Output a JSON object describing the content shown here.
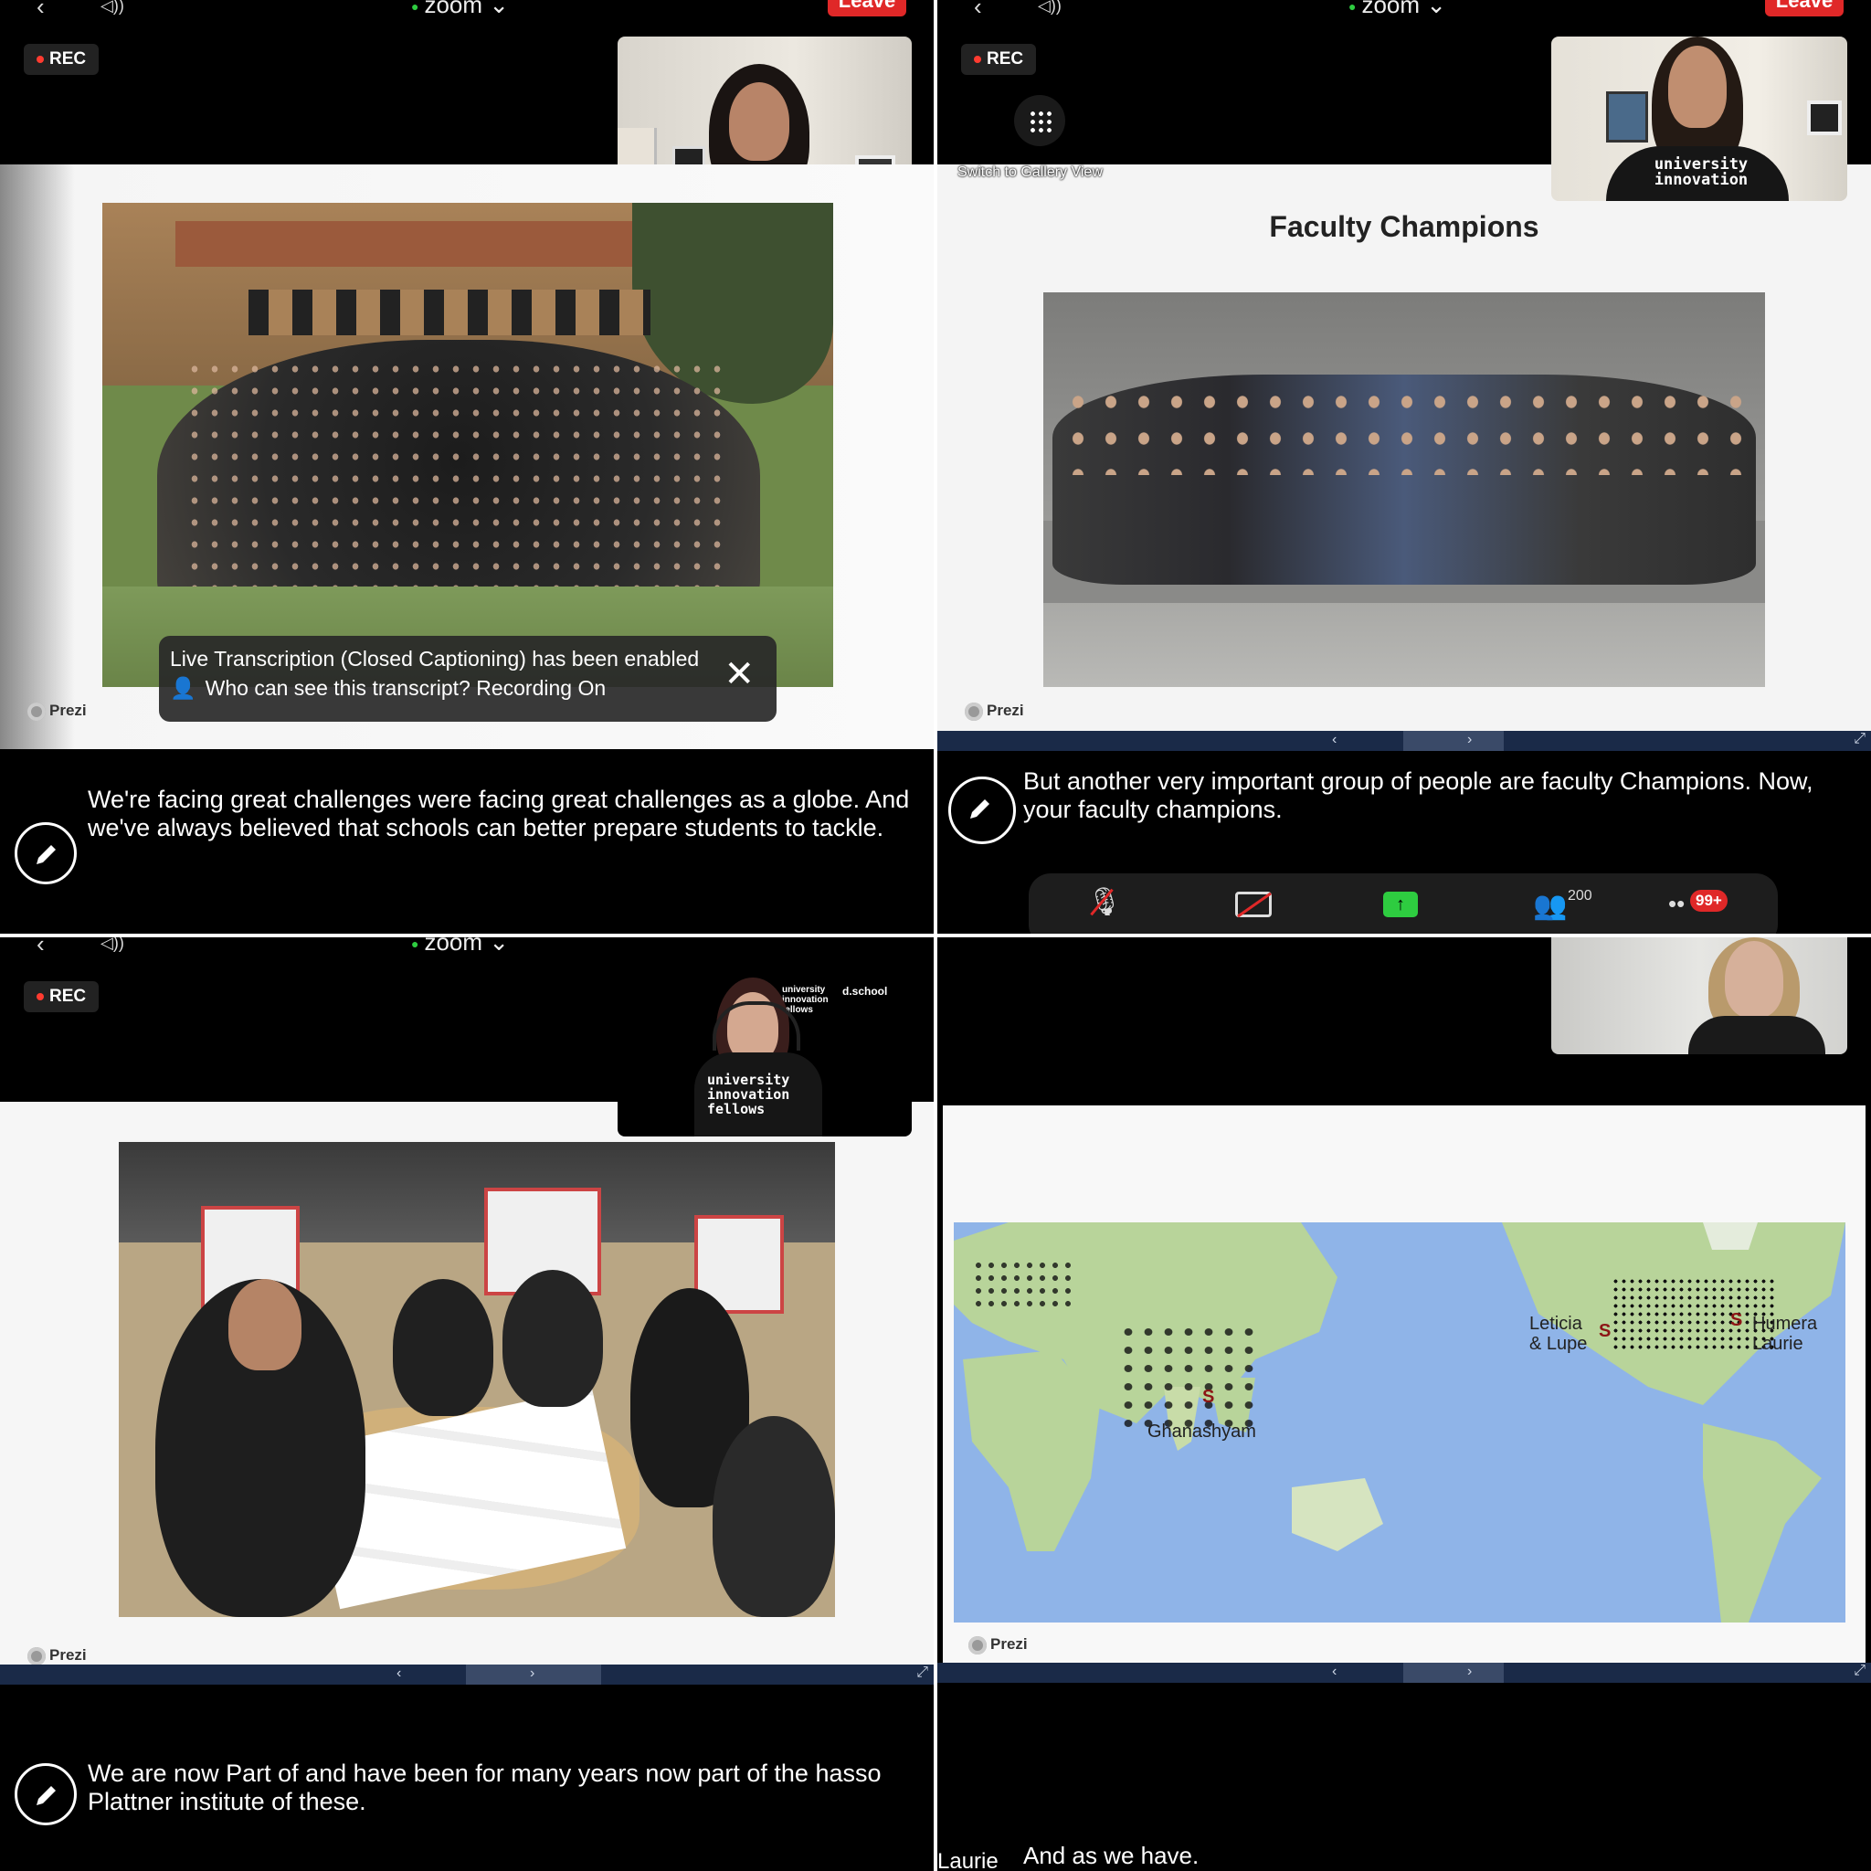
{
  "common": {
    "app_title": "zoom",
    "leave_label": "Leave",
    "rec_label": "REC",
    "prezi_label": "Prezi"
  },
  "q1": {
    "toast_line1": "Live Transcription (Closed Captioning) has been enabled",
    "toast_line2": "Who can see this transcript? Recording On",
    "caption": "We're facing great challenges were facing great challenges as a globe. And we've always believed that schools can better prepare students to tackle."
  },
  "q2": {
    "gallery_label": "Switch to Gallery View",
    "slide_title": "Faculty Champions",
    "caption": "But another very important group of people are faculty Champions. Now, your faculty champions.",
    "participants_count": "200",
    "more_badge": "99+",
    "shirt_text": "university innovation"
  },
  "q3": {
    "caption": "We are now Part of and have been for many years now part of the hasso Plattner institute of these.",
    "shirt_text": "university innovation fellows",
    "logo_text": "university innovation fellows",
    "dschool": "d.school"
  },
  "q4": {
    "labels": {
      "leticia": "Leticia & Lupe",
      "humera": "Humera Laurie",
      "ghanashyam": "Ghanashyam"
    },
    "caption": "And as we have.",
    "caption_prefix": "Laurie"
  },
  "colors": {
    "leave_red": "#e02828",
    "rec_dot": "#ff3b30",
    "share_green": "#2ecc40",
    "ocean": "#8fb4e8",
    "land": "#b8d49a"
  }
}
